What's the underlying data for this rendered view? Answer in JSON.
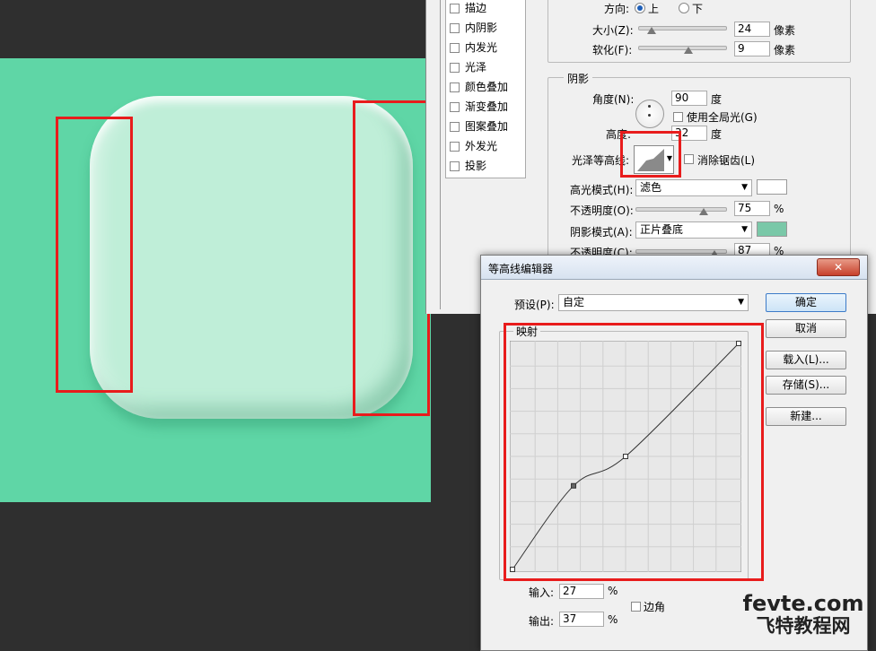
{
  "canvas": {
    "bg_color": "#5fd6a6",
    "icon_color": "#bfeed8"
  },
  "style_list": {
    "items": [
      "描边",
      "内阴影",
      "内发光",
      "光泽",
      "颜色叠加",
      "渐变叠加",
      "图案叠加",
      "外发光",
      "投影"
    ]
  },
  "structure": {
    "direction_label": "方向:",
    "direction_up": "上",
    "direction_down": "下",
    "size_label": "大小(Z):",
    "size_value": "24",
    "size_unit": "像素",
    "soften_label": "软化(F):",
    "soften_value": "9",
    "soften_unit": "像素"
  },
  "shading": {
    "group_title": "阴影",
    "angle_label": "角度(N):",
    "angle_value": "90",
    "angle_unit": "度",
    "global_light_label": "使用全局光(G)",
    "altitude_label": "高度:",
    "altitude_value": "32",
    "altitude_unit": "度",
    "gloss_contour_label": "光泽等高线:",
    "anti_alias_label": "消除锯齿(L)",
    "highlight_mode_label": "高光模式(H):",
    "highlight_mode_value": "滤色",
    "highlight_color": "#ffffff",
    "highlight_opacity_label": "不透明度(O):",
    "highlight_opacity_value": "75",
    "shadow_mode_label": "阴影模式(A):",
    "shadow_mode_value": "正片叠底",
    "shadow_color": "#7ac8a8",
    "shadow_opacity_label": "不透明度(C):",
    "shadow_opacity_value": "87",
    "percent": "%"
  },
  "contour_editor": {
    "title": "等高线编辑器",
    "close_symbol": "✕",
    "preset_label": "预设(P):",
    "preset_value": "自定",
    "mapping_label": "映射",
    "ok_label": "确定",
    "cancel_label": "取消",
    "load_label": "载入(L)...",
    "save_label": "存储(S)...",
    "new_label": "新建...",
    "input_label": "输入:",
    "input_value": "27",
    "output_label": "输出:",
    "output_value": "37",
    "percent": "%",
    "corner_label": "边角",
    "curve_points": [
      {
        "input": 0,
        "output": 0
      },
      {
        "input": 27,
        "output": 37
      },
      {
        "input": 50,
        "output": 50
      },
      {
        "input": 100,
        "output": 100
      }
    ]
  },
  "watermark": {
    "line1": "fevte.com",
    "line2": "飞特教程网"
  }
}
